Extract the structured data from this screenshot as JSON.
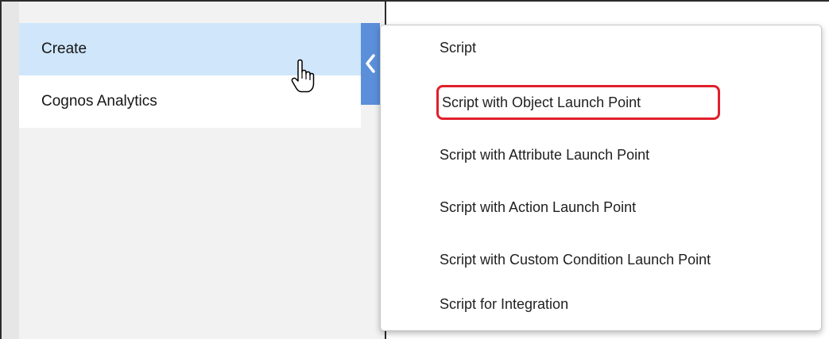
{
  "sidebar": {
    "items": [
      {
        "label": "Create",
        "state": "active"
      },
      {
        "label": "Cognos Analytics",
        "state": "normal"
      }
    ],
    "collapse_icon": "chevron-left-icon",
    "cursor_icon": "hand-pointer-icon"
  },
  "submenu": {
    "items": [
      {
        "label": "Script"
      },
      {
        "label": "Script with Object Launch Point",
        "highlighted": true
      },
      {
        "label": "Script with Attribute Launch Point"
      },
      {
        "label": "Script with Action Launch Point"
      },
      {
        "label": "Script with Custom Condition Launch Point"
      },
      {
        "label": "Script for Integration"
      }
    ]
  },
  "colors": {
    "active_item_bg": "#cfe6fb",
    "flyout_tab": "#5b8fd9",
    "highlight_border": "#e0202a"
  }
}
